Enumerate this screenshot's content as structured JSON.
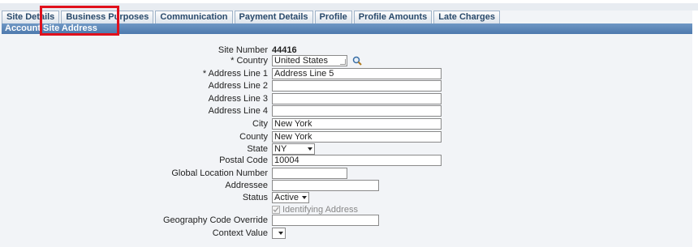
{
  "tabs": [
    {
      "label": "Site Details"
    },
    {
      "label": "Business Purposes"
    },
    {
      "label": "Communication"
    },
    {
      "label": "Payment Details"
    },
    {
      "label": "Profile"
    },
    {
      "label": "Profile Amounts"
    },
    {
      "label": "Late Charges"
    }
  ],
  "section": {
    "title": "Account Site Address"
  },
  "form": {
    "site_number": {
      "label": "Site Number",
      "value": "44416"
    },
    "country": {
      "label": "* Country",
      "value": "United States"
    },
    "address1": {
      "label": "* Address Line 1",
      "value": "Address Line 5"
    },
    "address2": {
      "label": "Address Line 2",
      "value": ""
    },
    "address3": {
      "label": "Address Line 3",
      "value": ""
    },
    "address4": {
      "label": "Address Line 4",
      "value": ""
    },
    "city": {
      "label": "City",
      "value": "New York"
    },
    "county": {
      "label": "County",
      "value": "New York"
    },
    "state": {
      "label": "State",
      "value": "NY"
    },
    "postal_code": {
      "label": "Postal Code",
      "value": "10004"
    },
    "gln": {
      "label": "Global Location Number",
      "value": ""
    },
    "addressee": {
      "label": "Addressee",
      "value": ""
    },
    "status": {
      "label": "Status",
      "value": "Active"
    },
    "identifying": {
      "label": "Identifying Address",
      "checked": true
    },
    "geo_override": {
      "label": "Geography Code Override",
      "value": ""
    },
    "context": {
      "label": "Context Value",
      "value": ""
    }
  },
  "colors": {
    "highlight": "#e0101c",
    "header": "#5580b3"
  }
}
